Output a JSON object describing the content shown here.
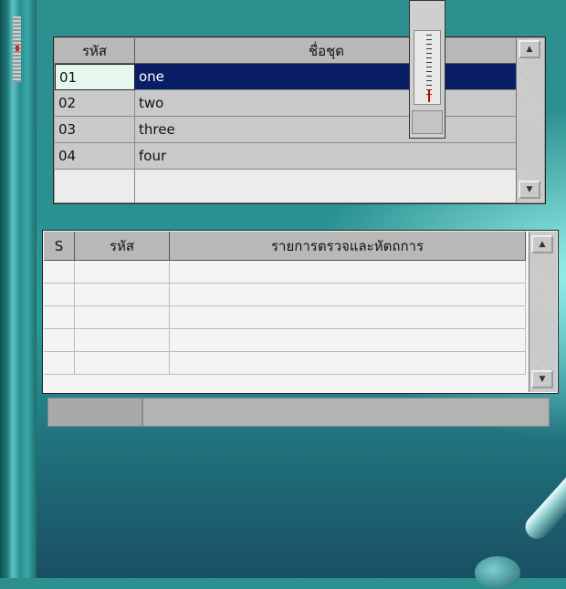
{
  "grid1": {
    "headers": [
      "รหัส",
      "ชื่อชุด"
    ],
    "rows": [
      {
        "code": "01",
        "name": "one"
      },
      {
        "code": "02",
        "name": "two"
      },
      {
        "code": "03",
        "name": "three"
      },
      {
        "code": "04",
        "name": "four"
      },
      {
        "code": "",
        "name": ""
      }
    ],
    "selected_row": 0
  },
  "grid2": {
    "headers": [
      "S",
      "รหัส",
      "รายการตรวจและหัตถการ"
    ],
    "empty_row_count": 5
  },
  "icons": {
    "scroll_up": "triangle-up-icon",
    "scroll_down": "triangle-down-icon",
    "thermometer": "thermometer-icon"
  },
  "colors": {
    "selection": "#0a1e66",
    "background_teal": "#2a9090",
    "grid_gray": "#a6a6a6"
  }
}
